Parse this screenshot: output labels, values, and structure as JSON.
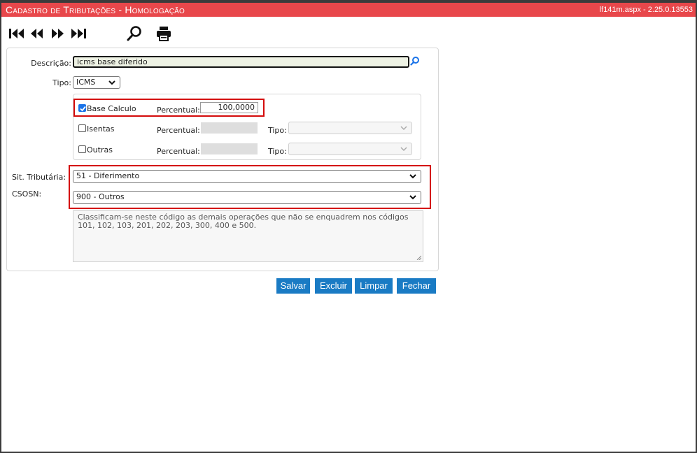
{
  "window": {
    "title": "Cadastro de Tributações  - Homologação",
    "version": "lf141m.aspx - 2.25.0.13553"
  },
  "toolbar": {
    "icons": [
      "first-record-icon",
      "previous-record-icon",
      "next-record-icon",
      "last-record-icon",
      "search-icon",
      "print-icon"
    ]
  },
  "form": {
    "descricao_label": "Descrição:",
    "descricao_value": "icms base diferido",
    "tipo_label": "Tipo:",
    "tipo_value": "ICMS",
    "base_calculo": {
      "label": "Base Calculo",
      "checked": true,
      "percentual_label": "Percentual:",
      "percentual_value": "100,0000"
    },
    "isentas": {
      "label": "Isentas",
      "checked": false,
      "percentual_label": "Percentual:",
      "percentual_value": "",
      "tipo_label": "Tipo:",
      "tipo_value": ""
    },
    "outras": {
      "label": "Outras",
      "checked": false,
      "percentual_label": "Percentual:",
      "percentual_value": "",
      "tipo_label": "Tipo:",
      "tipo_value": ""
    },
    "sit_tributaria_label": "Sit. Tributária:",
    "sit_tributaria_value": "51 - Diferimento",
    "csosn_label": "CSOSN:",
    "csosn_value": "900 - Outros",
    "csosn_description": "Classificam-se neste código as demais operações que não se enquadrem nos códigos 101, 102, 103, 201, 202, 203, 300, 400 e 500."
  },
  "buttons": {
    "salvar": "Salvar",
    "excluir": "Excluir",
    "limpar": "Limpar",
    "fechar": "Fechar"
  },
  "colors": {
    "titlebar": "#e8474b",
    "button": "#1a7bc4",
    "highlight": "#d40a0a",
    "checkbox_checked": "#1a73e8"
  }
}
